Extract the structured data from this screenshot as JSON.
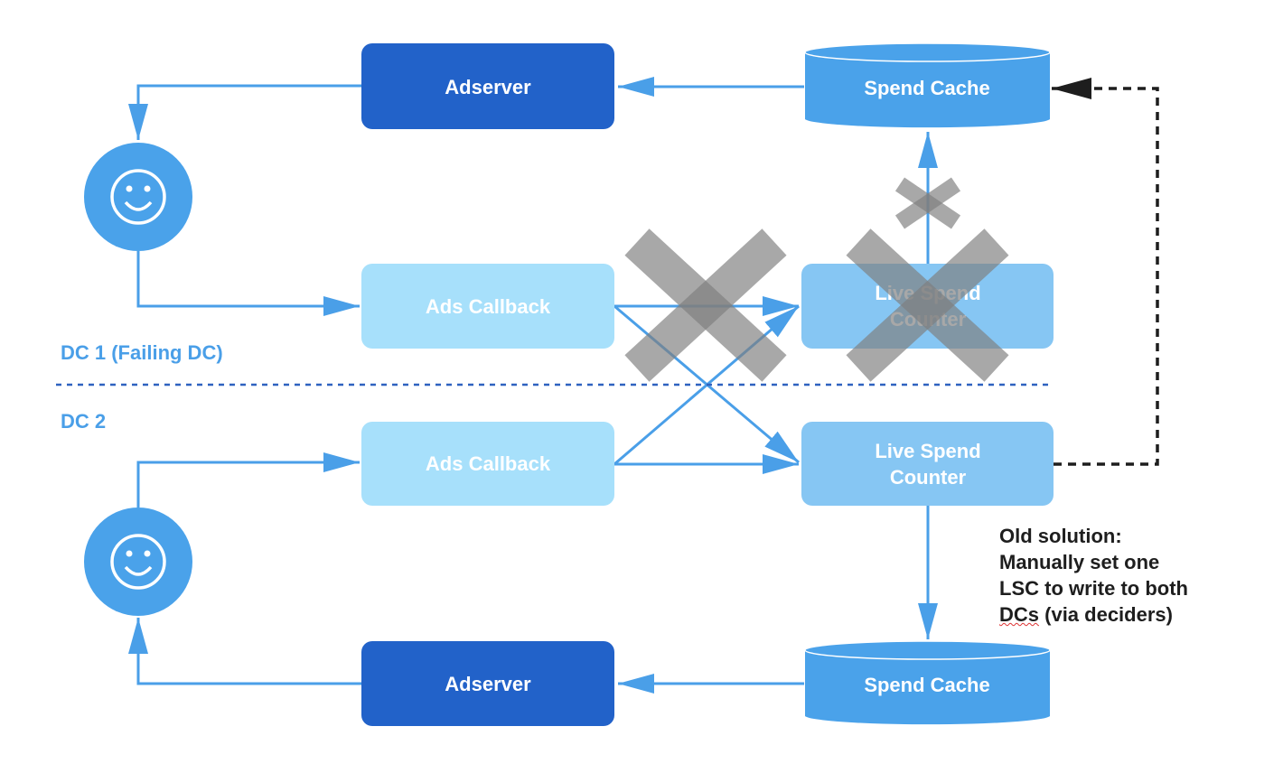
{
  "nodes": {
    "adserver_top": "Adserver",
    "adserver_bottom": "Adserver",
    "spend_cache_top": "Spend Cache",
    "spend_cache_bottom": "Spend Cache",
    "ads_callback_top": "Ads Callback",
    "ads_callback_bottom": "Ads Callback",
    "lsc_top": [
      "Live Spend",
      "Counter"
    ],
    "lsc_bottom": [
      "Live Spend",
      "Counter"
    ]
  },
  "labels": {
    "dc1": "DC 1 (Failing DC)",
    "dc2": "DC 2"
  },
  "note": {
    "lines": [
      "Old solution:",
      "Manually set one",
      "LSC to write to both",
      "DCs",
      " (via deciders)"
    ]
  },
  "icons": {
    "user": "smiley-face-icon",
    "failure": "x-mark-icon"
  },
  "colors": {
    "adserver": "#2262C9",
    "ads_callback": "#A7E0FB",
    "lsc": "#86C6F3",
    "spend_cache": "#4AA2EA",
    "arrow": "#4A9FE8",
    "failure_mark": "#7f7f7f",
    "divider": "#2F62C0"
  }
}
